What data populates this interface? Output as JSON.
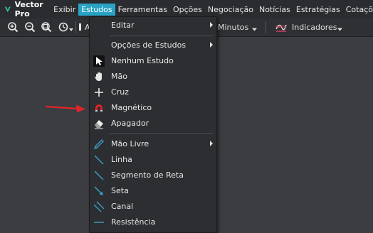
{
  "app": {
    "name": "Vector Pro"
  },
  "menubar": {
    "items": [
      "Exibir",
      "Estudos",
      "Ferramentas",
      "Opções",
      "Negociação",
      "Notícias",
      "Estratégias",
      "Cotações"
    ],
    "active": "Estudos"
  },
  "toolbar": {
    "icons": [
      "zoom-in-icon",
      "zoom-out-icon",
      "zoom-fit-icon",
      "history-icon"
    ],
    "truncated_label": "A",
    "period_label": "Minutos",
    "indicators_label": "Indicadores"
  },
  "dropdown": {
    "items": [
      {
        "label": "Editar",
        "submenu": true,
        "icon": ""
      },
      {
        "label": "Opções de Estudos",
        "submenu": true,
        "icon": ""
      },
      {
        "label": "Nenhum Estudo",
        "submenu": false,
        "icon": "pointer-icon"
      },
      {
        "label": "Mão",
        "submenu": false,
        "icon": "hand-icon"
      },
      {
        "label": "Cruz",
        "submenu": false,
        "icon": "crosshair-icon"
      },
      {
        "label": "Magnético",
        "submenu": false,
        "icon": "magnet-icon"
      },
      {
        "label": "Apagador",
        "submenu": false,
        "icon": "eraser-icon"
      },
      {
        "label": "Mão Livre",
        "submenu": true,
        "icon": "freehand-icon"
      },
      {
        "label": "Linha",
        "submenu": false,
        "icon": "line-icon"
      },
      {
        "label": "Segmento de Reta",
        "submenu": false,
        "icon": "segment-icon"
      },
      {
        "label": "Seta",
        "submenu": false,
        "icon": "arrow-line-icon"
      },
      {
        "label": "Canal",
        "submenu": false,
        "icon": "channel-icon"
      },
      {
        "label": "Resistência",
        "submenu": false,
        "icon": "horizontal-line-icon"
      }
    ]
  },
  "colors": {
    "menu_active": "#2aa3c4",
    "logo": "#2ec4a9",
    "annotation_arrow": "#e0242a",
    "magnet": "#e0242a",
    "drawing_tools": "#3aa0c8"
  }
}
